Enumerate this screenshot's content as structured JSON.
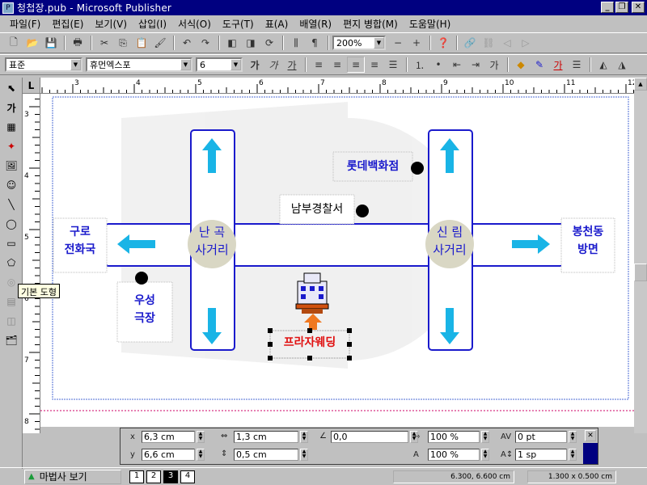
{
  "window": {
    "title": "청첩장.pub - Microsoft Publisher",
    "minimize": "_",
    "restore": "❐",
    "close": "✕"
  },
  "menu": [
    "파일(F)",
    "편집(E)",
    "보기(V)",
    "삽입(I)",
    "서식(O)",
    "도구(T)",
    "표(A)",
    "배열(R)",
    "편지 병합(M)",
    "도움말(H)"
  ],
  "toolbar": {
    "zoom": "200%",
    "zoom_minus": "−",
    "zoom_plus": "+"
  },
  "format_toolbar": {
    "style": "표준",
    "font": "휴먼엑스포",
    "size": "6",
    "bold": "가",
    "italic": "가",
    "underline": "가",
    "fx": "가",
    "fontcolor": "가"
  },
  "ruler": {
    "h_ticks": [
      "3",
      "4",
      "5",
      "6",
      "7",
      "8",
      "9",
      "10",
      "11",
      "12"
    ],
    "v_ticks": [
      "3",
      "4",
      "5",
      "6",
      "7",
      "8"
    ],
    "corner": "L"
  },
  "tooltip": "기본 도형",
  "map": {
    "intersection_left": [
      "난 곡",
      "사거리"
    ],
    "intersection_right": [
      "신 림",
      "사거리"
    ],
    "left_label": [
      "구로",
      "전화국"
    ],
    "right_label": [
      "봉천동",
      "방면"
    ],
    "lotte": "롯데백화점",
    "police": "남부경찰서",
    "theater": [
      "우성",
      "극장"
    ],
    "venue": "프라자웨딩"
  },
  "measurement": {
    "x_label": "x",
    "x_value": "6,3 cm",
    "y_label": "y",
    "y_value": "6,6 cm",
    "w_value": "1,3 cm",
    "h_value": "0,5 cm",
    "rot_value": "0,0",
    "scale1": "100 %",
    "scale2": "100 %",
    "track_value": "0 pt",
    "line_value": "1 sp",
    "close": "✕"
  },
  "status": {
    "wizard": "마법사 보기",
    "pages": [
      "1",
      "2",
      "3",
      "4"
    ],
    "active_page": "3",
    "position": "6.300, 6.600 cm",
    "size": "1.300 x 0.500 cm"
  },
  "colors": {
    "title_bg": "#000080",
    "road": "#1a1acc",
    "arrow": "#19b4e6",
    "venue_text": "#e01010",
    "circle": "#d9d7c4"
  }
}
